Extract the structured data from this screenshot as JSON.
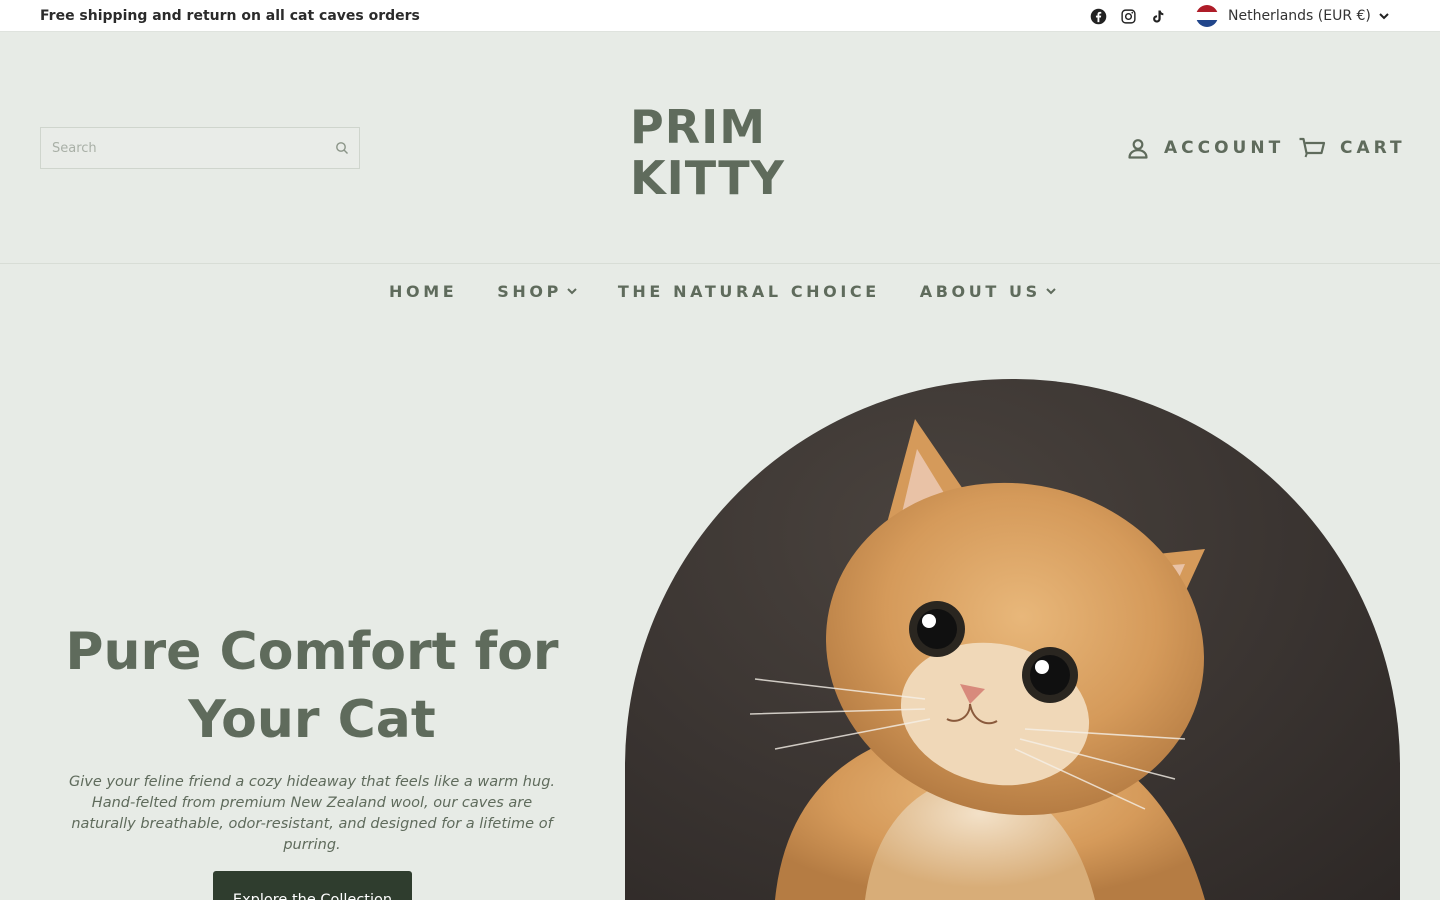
{
  "announcement": {
    "text": "Free shipping and return on all cat caves orders"
  },
  "social": [
    "facebook-icon",
    "instagram-icon",
    "tiktok-icon"
  ],
  "locale": {
    "label": "Netherlands (EUR €)",
    "flag_colors": [
      "#ae1c28",
      "#ffffff",
      "#21468b"
    ]
  },
  "header": {
    "search_placeholder": "Search",
    "logo_line1": "PRIM",
    "logo_line2": "KITTY",
    "account_label": "ACCOUNT",
    "cart_label": "CART"
  },
  "nav": [
    {
      "label": "HOME",
      "dropdown": false
    },
    {
      "label": "SHOP",
      "dropdown": true
    },
    {
      "label": "THE NATURAL CHOICE",
      "dropdown": false
    },
    {
      "label": "ABOUT US",
      "dropdown": true
    }
  ],
  "hero": {
    "title": "Pure Comfort for Your Cat",
    "text": "Give your feline friend a cozy hideaway that feels like a warm hug. Hand-felted from premium New Zealand wool, our caves are naturally breathable, odor-resistant, and designed for a lifetime of purring.",
    "button_label": "Explore the Collection"
  },
  "colors": {
    "brand": "#5f6b5c",
    "background": "#e7ebe6",
    "button": "#2f3d2e"
  }
}
